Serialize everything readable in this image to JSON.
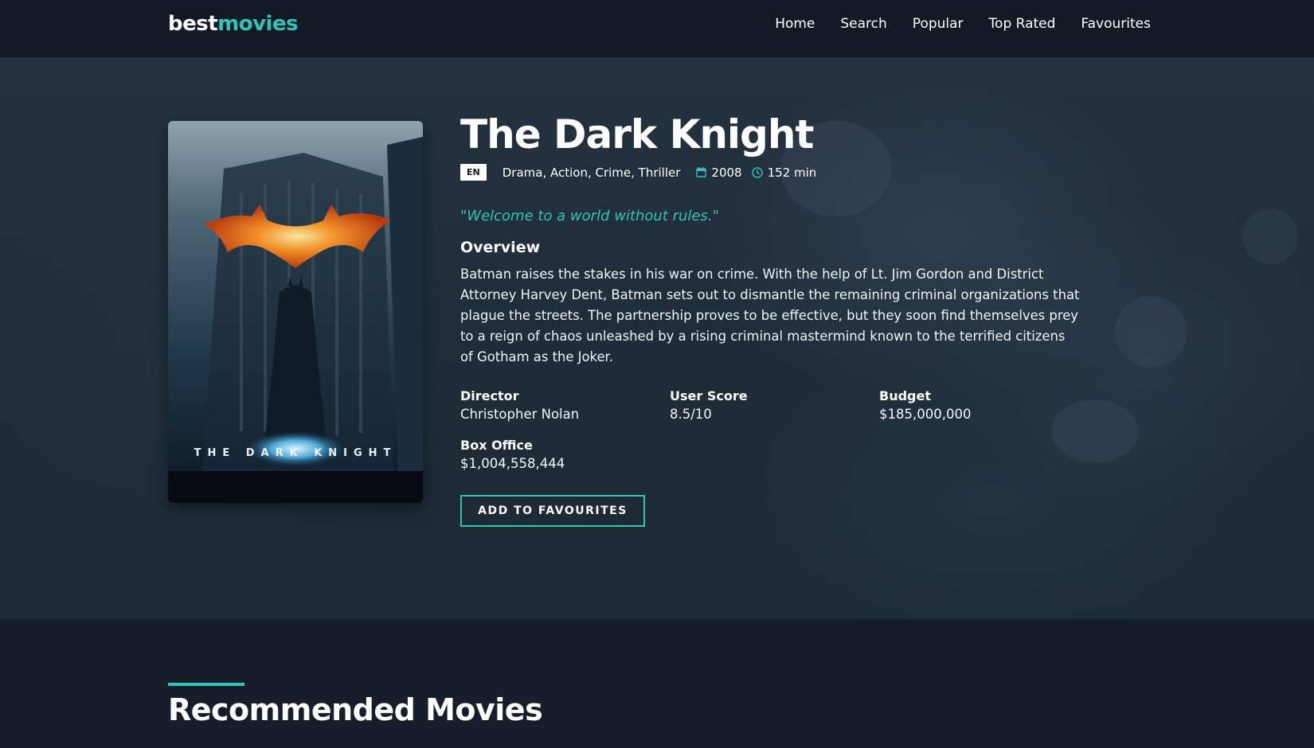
{
  "nav": {
    "logo_part1": "best",
    "logo_part2": "movies",
    "links": [
      "Home",
      "Search",
      "Popular",
      "Top Rated",
      "Favourites"
    ]
  },
  "movie": {
    "title": "The Dark Knight",
    "language": "EN",
    "genres": "Drama, Action, Crime, Thriller",
    "year": "2008",
    "runtime": "152 min",
    "tagline": "\"Welcome to a world without rules.\"",
    "overview_heading": "Overview",
    "overview": "Batman raises the stakes in his war on crime. With the help of Lt. Jim Gordon and District Attorney Harvey Dent, Batman sets out to dismantle the remaining criminal organizations that plague the streets. The partnership proves to be effective, but they soon find themselves prey to a reign of chaos unleashed by a rising criminal mastermind known to the terrified citizens of Gotham as the Joker.",
    "poster_title": "THE DARK KNIGHT",
    "facts": {
      "director_label": "Director",
      "director": "Christopher Nolan",
      "score_label": "User Score",
      "score": "8.5/10",
      "budget_label": "Budget",
      "budget": "$185,000,000",
      "box_office_label": "Box Office",
      "box_office": "$1,004,558,444"
    },
    "favourite_button": "ADD TO FAVOURITES"
  },
  "recommended": {
    "heading": "Recommended Movies"
  },
  "colors": {
    "accent": "#2ec4b6",
    "navbar": "#121a26",
    "background": "#161d2b"
  },
  "icons": {
    "year": "calendar-icon",
    "runtime": "clock-icon"
  }
}
